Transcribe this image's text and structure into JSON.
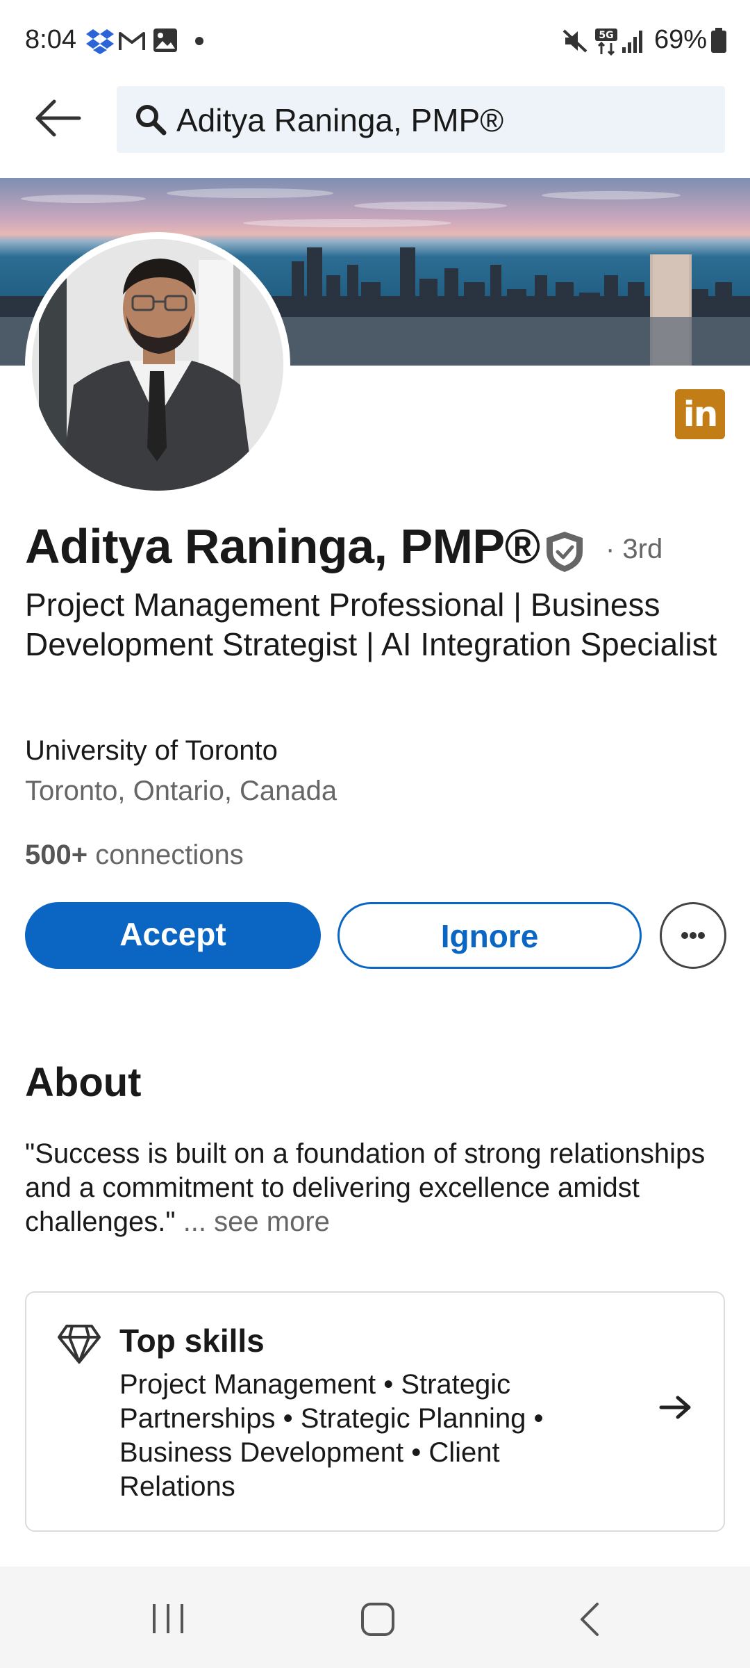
{
  "status_bar": {
    "time": "8:04",
    "battery": "69%",
    "left_icons": [
      "dropbox-icon",
      "gmail-icon",
      "gallery-icon",
      "notification-dot-icon"
    ],
    "right_icons": [
      "mute-icon",
      "5g-icon",
      "signal-icon",
      "battery-icon"
    ]
  },
  "search": {
    "query": "Aditya Raninga, PMP®"
  },
  "profile": {
    "name": "Aditya Raninga, PMP®",
    "degree": "· 3rd",
    "headline": "Project Management Professional | Business Development Strategist | AI Integration Specialist",
    "education": "University of Toronto",
    "location": "Toronto, Ontario, Canada",
    "connections_count": "500+",
    "connections_label": "connections"
  },
  "actions": {
    "accept": "Accept",
    "ignore": "Ignore"
  },
  "about": {
    "heading": "About",
    "text": "\"Success is built on a foundation of strong relationships and a commitment to delivering excellence amidst challenges.\"",
    "see_more": "... see more"
  },
  "top_skills": {
    "title": "Top skills",
    "skills": "Project Management • Strategic Partnerships • Strategic Planning • Business Development • Client Relations"
  },
  "colors": {
    "primary": "#0a66c2",
    "linkedin_badge": "#c37d16",
    "secondary_text": "#666666"
  }
}
